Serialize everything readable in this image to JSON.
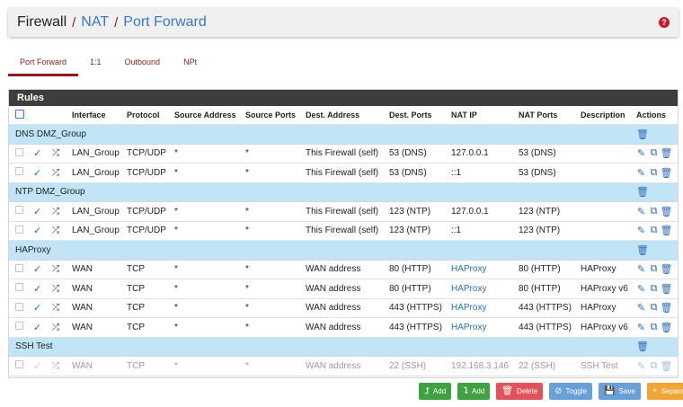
{
  "header": {
    "crumbs": [
      "Firewall",
      "NAT",
      "Port Forward"
    ],
    "help": "?"
  },
  "tabs": [
    {
      "label": "Port Forward",
      "active": true
    },
    {
      "label": "1:1",
      "active": false
    },
    {
      "label": "Outbound",
      "active": false
    },
    {
      "label": "NPt",
      "active": false
    }
  ],
  "panel": {
    "title": "Rules",
    "columns": {
      "interface": "Interface",
      "protocol": "Protocol",
      "source_address": "Source Address",
      "source_ports": "Source Ports",
      "dest_address": "Dest. Address",
      "dest_ports": "Dest. Ports",
      "nat_ip": "NAT IP",
      "nat_ports": "NAT Ports",
      "description": "Description",
      "actions": "Actions"
    }
  },
  "groups": [
    {
      "name": "DNS DMZ_Group",
      "rules": [
        {
          "interface": "LAN_Group",
          "protocol": "TCP/UDP",
          "src": "*",
          "sport": "*",
          "dst": "This Firewall (self)",
          "dport": "53 (DNS)",
          "nat_ip": "127.0.0.1",
          "nat_port": "53 (DNS)",
          "desc": ""
        },
        {
          "interface": "LAN_Group",
          "protocol": "TCP/UDP",
          "src": "*",
          "sport": "*",
          "dst": "This Firewall (self)",
          "dport": "53 (DNS)",
          "nat_ip": "::1",
          "nat_port": "53 (DNS)",
          "desc": ""
        }
      ]
    },
    {
      "name": "NTP DMZ_Group",
      "rules": [
        {
          "interface": "LAN_Group",
          "protocol": "TCP/UDP",
          "src": "*",
          "sport": "*",
          "dst": "This Firewall (self)",
          "dport": "123 (NTP)",
          "nat_ip": "127.0.0.1",
          "nat_port": "123 (NTP)",
          "desc": ""
        },
        {
          "interface": "LAN_Group",
          "protocol": "TCP/UDP",
          "src": "*",
          "sport": "*",
          "dst": "This Firewall (self)",
          "dport": "123 (NTP)",
          "nat_ip": "::1",
          "nat_port": "123 (NTP)",
          "desc": ""
        }
      ]
    },
    {
      "name": "HAProxy",
      "rules": [
        {
          "interface": "WAN",
          "protocol": "TCP",
          "src": "*",
          "sport": "*",
          "dst": "WAN address",
          "dport": "80 (HTTP)",
          "nat_ip": "HAProxy",
          "nat_port": "80 (HTTP)",
          "desc": "HAProxy"
        },
        {
          "interface": "WAN",
          "protocol": "TCP",
          "src": "*",
          "sport": "*",
          "dst": "WAN address",
          "dport": "80 (HTTP)",
          "nat_ip": "HAProxy",
          "nat_port": "80 (HTTP)",
          "desc": "HAProxy v6"
        },
        {
          "interface": "WAN",
          "protocol": "TCP",
          "src": "*",
          "sport": "*",
          "dst": "WAN address",
          "dport": "443 (HTTPS)",
          "nat_ip": "HAProxy",
          "nat_port": "443 (HTTPS)",
          "desc": "HAProxy"
        },
        {
          "interface": "WAN",
          "protocol": "TCP",
          "src": "*",
          "sport": "*",
          "dst": "WAN address",
          "dport": "443 (HTTPS)",
          "nat_ip": "HAProxy",
          "nat_port": "443 (HTTPS)",
          "desc": "HAProxy v6"
        }
      ]
    },
    {
      "name": "SSH Test",
      "rules": [
        {
          "interface": "WAN",
          "protocol": "TCP",
          "src": "*",
          "sport": "*",
          "dst": "WAN address",
          "dport": "22 (SSH)",
          "nat_ip": "192.168.3.146",
          "nat_port": "22 (SSH)",
          "desc": "SSH Test",
          "disabled": true
        }
      ]
    }
  ],
  "footer": {
    "buttons": [
      {
        "label": "Add",
        "icon": "arrow-up-icon",
        "color": "#3fa142"
      },
      {
        "label": "Add",
        "icon": "arrow-down-icon",
        "color": "#3fa142"
      },
      {
        "label": "Delete",
        "icon": "trash-icon",
        "color": "#e0535a"
      },
      {
        "label": "Toggle",
        "icon": "ban-icon",
        "color": "#6aa0d8"
      },
      {
        "label": "Save",
        "icon": "save-icon",
        "color": "#6aa0d8"
      },
      {
        "label": "Separator",
        "icon": "plus-icon",
        "color": "#f0a535"
      }
    ]
  }
}
